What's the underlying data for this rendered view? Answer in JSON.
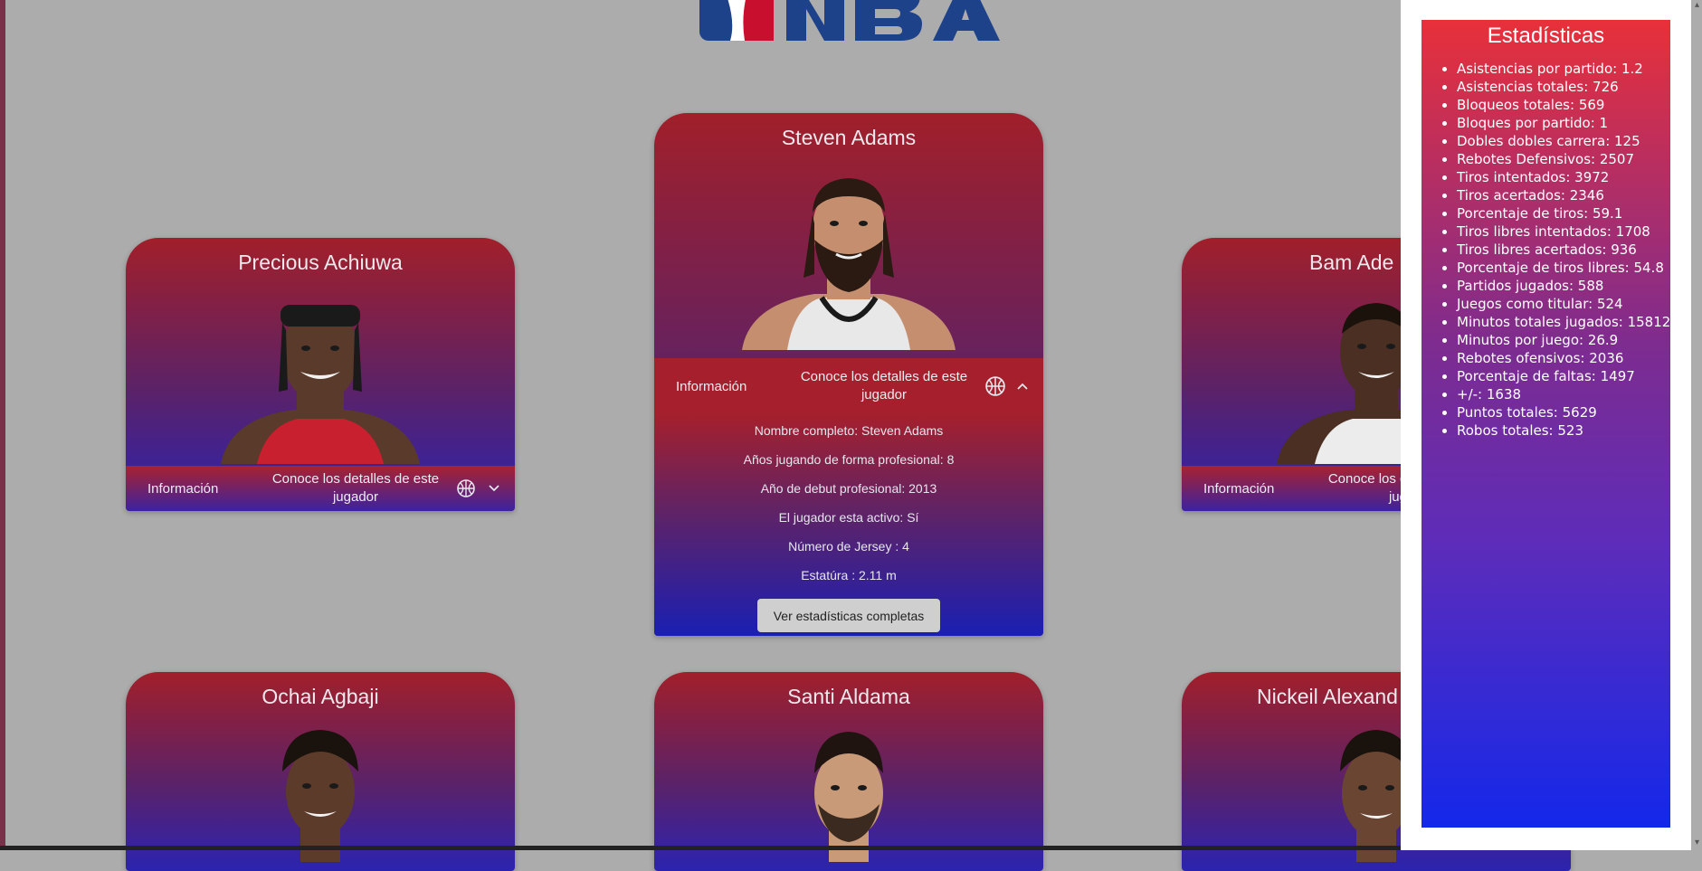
{
  "logo": {
    "icon": "nba-logo",
    "text": "NBA"
  },
  "info_label": "Información",
  "info_desc": "Conoce los detalles de este jugador",
  "players": [
    {
      "name": "Precious Achiuwa",
      "jersey_color": "#c8202f",
      "skin": "#5a3a2a"
    },
    {
      "name": "Steven Adams",
      "jersey_color": "#e8e8e8",
      "skin": "#c58f6f"
    },
    {
      "name": "Bam Adebayo",
      "visible_name": "Bam Ade",
      "jersey_color": "#ececec",
      "skin": "#4a2f22"
    },
    {
      "name": "Ochai Agbaji",
      "skin": "#5c3b2b"
    },
    {
      "name": "Santi Aldama",
      "skin": "#c99a78"
    },
    {
      "name": "Nickeil Alexander",
      "visible_name": "Nickeil Alexand",
      "skin": "#6a4532"
    }
  ],
  "expanded": {
    "details": [
      "Nombre completo: Steven Adams",
      "Años jugando de forma profesional: 8",
      "Año de debut profesional: 2013",
      "El jugador esta activo: Sí",
      "Número de Jersey : 4",
      "Estatúra : 2.11 m"
    ],
    "button_label": "Ver estadísticas completas"
  },
  "stats_panel": {
    "title": "Estadísticas",
    "items": [
      "Asistencias por partido: 1.2",
      "Asistencias totales: 726",
      "Bloqueos totales: 569",
      "Bloques por partido: 1",
      "Dobles dobles carrera: 125",
      "Rebotes Defensivos: 2507",
      "Tiros intentados: 3972",
      "Tiros acertados: 2346",
      "Porcentaje de tiros: 59.1",
      "Tiros libres intentados: 1708",
      "Tiros libres acertados: 936",
      "Porcentaje de tiros libres: 54.8",
      "Partidos jugados: 588",
      "Juegos como titular: 524",
      "Minutos totales jugados: 15812",
      "Minutos por juego: 26.9",
      "Rebotes ofensivos: 2036",
      "Porcentaje de faltas: 1497",
      "+/-: 1638",
      "Puntos totales: 5629",
      "Robos totales: 523"
    ]
  },
  "colors": {
    "background": "#acacac",
    "card_top": "#a11f2a",
    "card_bottom": "#2b23b0",
    "panel_top": "#e8303a",
    "panel_bottom": "#1428ea"
  }
}
